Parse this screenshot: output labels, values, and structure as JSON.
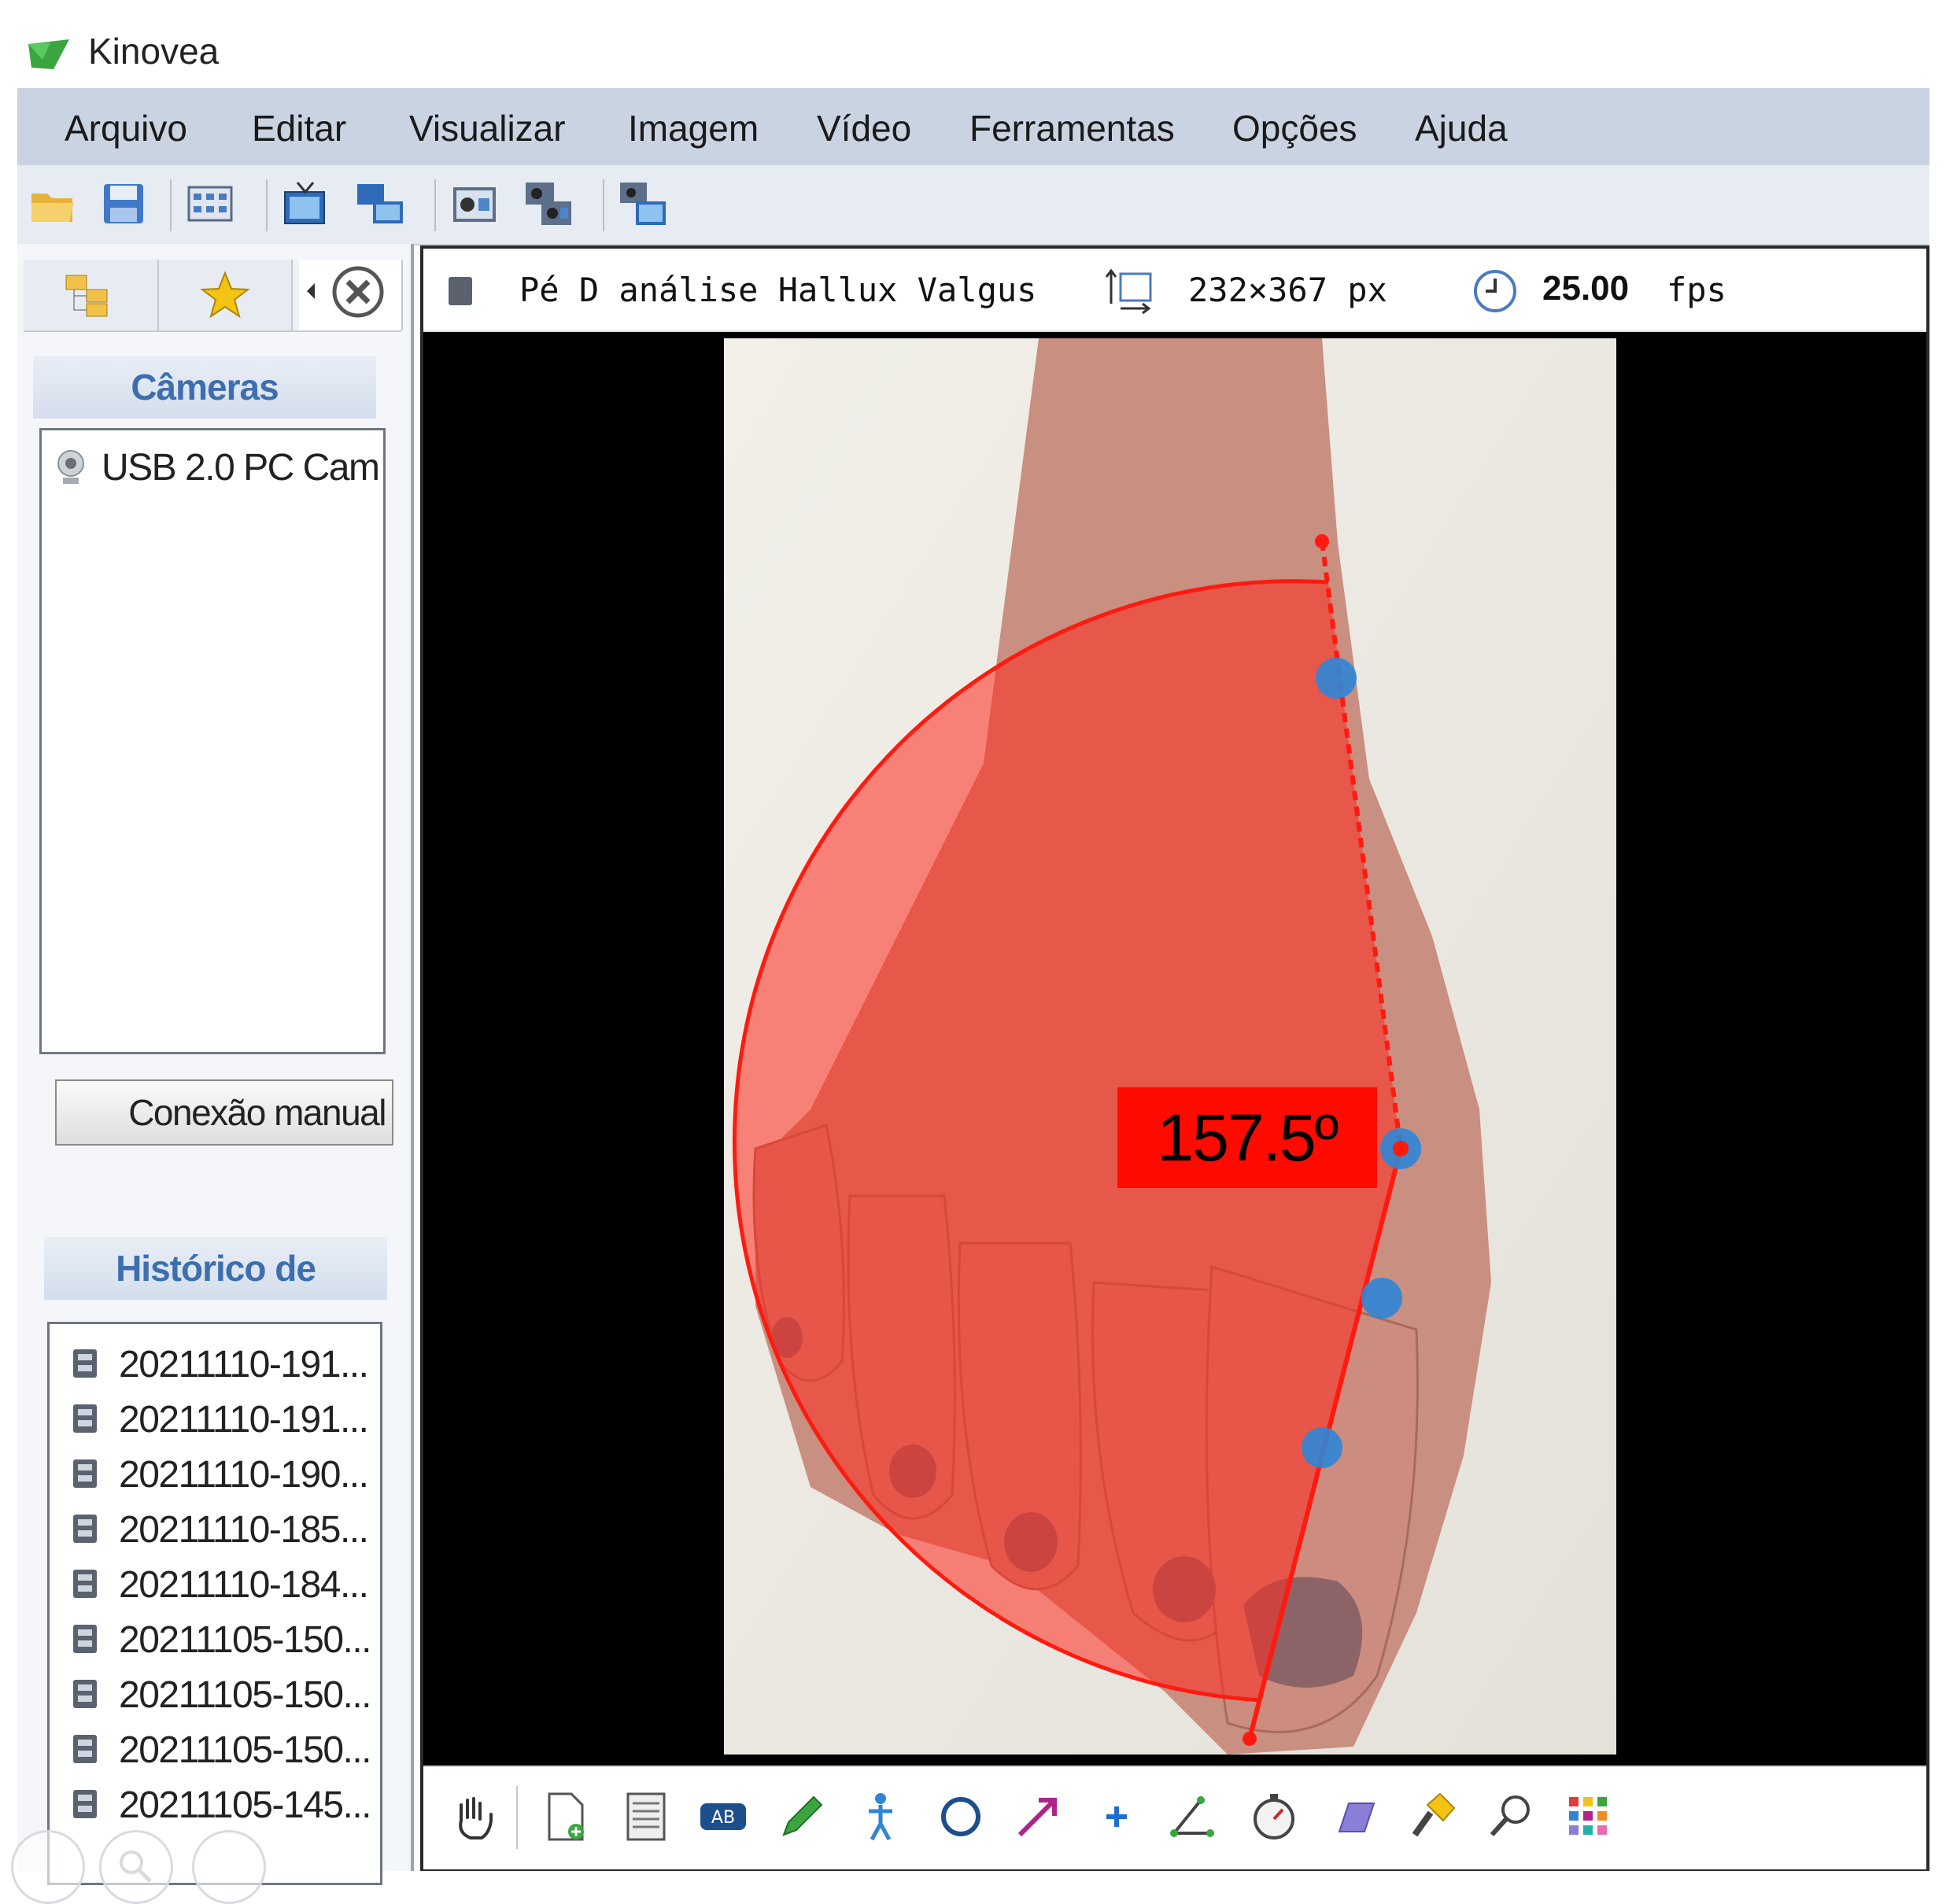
{
  "window": {
    "title": "Kinovea"
  },
  "menu": {
    "items": [
      "Arquivo",
      "Editar",
      "Visualizar",
      "Imagem",
      "Vídeo",
      "Ferramentas",
      "Opções",
      "Ajuda"
    ]
  },
  "left_panel": {
    "cameras_header": "Câmeras",
    "cameras": [
      {
        "label": "USB 2.0 PC Cam"
      }
    ],
    "manual_connection_button": "Conexão manual",
    "history_header": "Histórico de",
    "history": [
      "20211110-191...",
      "20211110-191...",
      "20211110-190...",
      "20211110-185...",
      "20211110-184...",
      "20211105-150...",
      "20211105-150...",
      "20211105-150...",
      "20211105-145..."
    ]
  },
  "player": {
    "file_name": "Pé D análise Hallux Valgus",
    "resolution": "232×367 px",
    "framerate": "25.00",
    "framerate_unit": "fps",
    "angle_label": "157.5º"
  },
  "colors": {
    "menubar": "#c9d3e2",
    "section_header_text": "#3d6fb0",
    "angle_overlay": "#ff2a1e",
    "marker": "#2f86d6"
  },
  "icons": {
    "toolbar": [
      "open-folder-icon",
      "save-icon",
      "thumbnails-icon",
      "single-player-icon",
      "dual-player-icon",
      "capture-icon",
      "dual-capture-icon",
      "capture-mixed-icon"
    ],
    "drawing_tools": [
      "hand-icon",
      "add-keyframe-icon",
      "comments-icon",
      "label-icon",
      "pencil-icon",
      "human-model-icon",
      "circle-icon",
      "arrow-icon",
      "cross-marker-icon",
      "angle-icon",
      "chronometer-icon",
      "plane-icon",
      "spotlight-icon",
      "magnifier-icon",
      "color-grid-icon"
    ]
  }
}
